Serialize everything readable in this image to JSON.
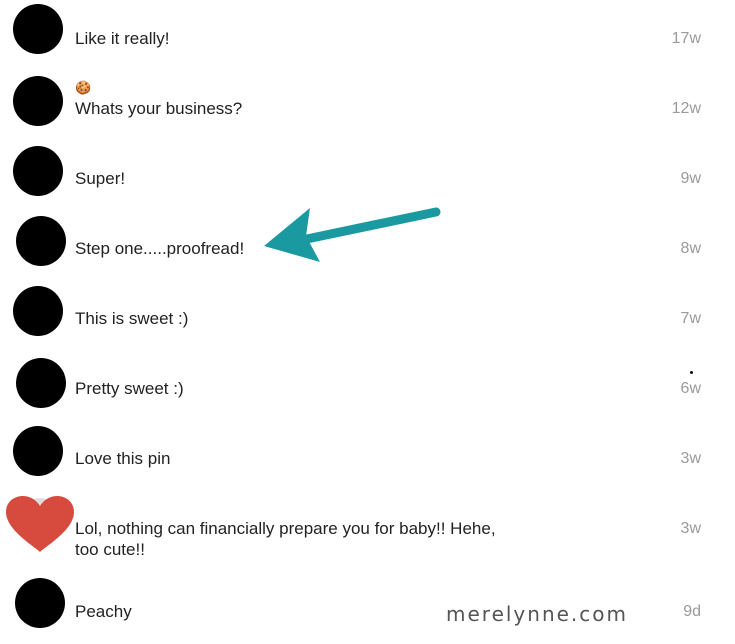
{
  "comments": [
    {
      "text": "Like it really!",
      "time": "17w",
      "emoji": ""
    },
    {
      "text": "Whats your business?",
      "time": "12w",
      "emoji": "🍪"
    },
    {
      "text": "Super!",
      "time": "9w",
      "emoji": ""
    },
    {
      "text": "Step one.....proofread!",
      "time": "8w",
      "emoji": ""
    },
    {
      "text": "This is sweet :)",
      "time": "7w",
      "emoji": ""
    },
    {
      "text": "Pretty sweet :)",
      "time": "6w",
      "emoji": ""
    },
    {
      "text": "Love this pin",
      "time": "3w",
      "emoji": ""
    },
    {
      "text": "Lol, nothing can financially prepare you for baby!! Hehe,\ntoo cute!!",
      "time": "3w",
      "emoji": ""
    },
    {
      "text": "Peachy",
      "time": "9d",
      "emoji": ""
    }
  ],
  "watermark": "merelynne.com",
  "colors": {
    "arrow": "#1a9aa0",
    "heart": "#d64b3e",
    "timestamp": "#9a9a9a"
  },
  "icons": {
    "avatar": "avatar-circle",
    "heart_avatar": "heart-icon",
    "arrow": "arrow-left-icon"
  }
}
